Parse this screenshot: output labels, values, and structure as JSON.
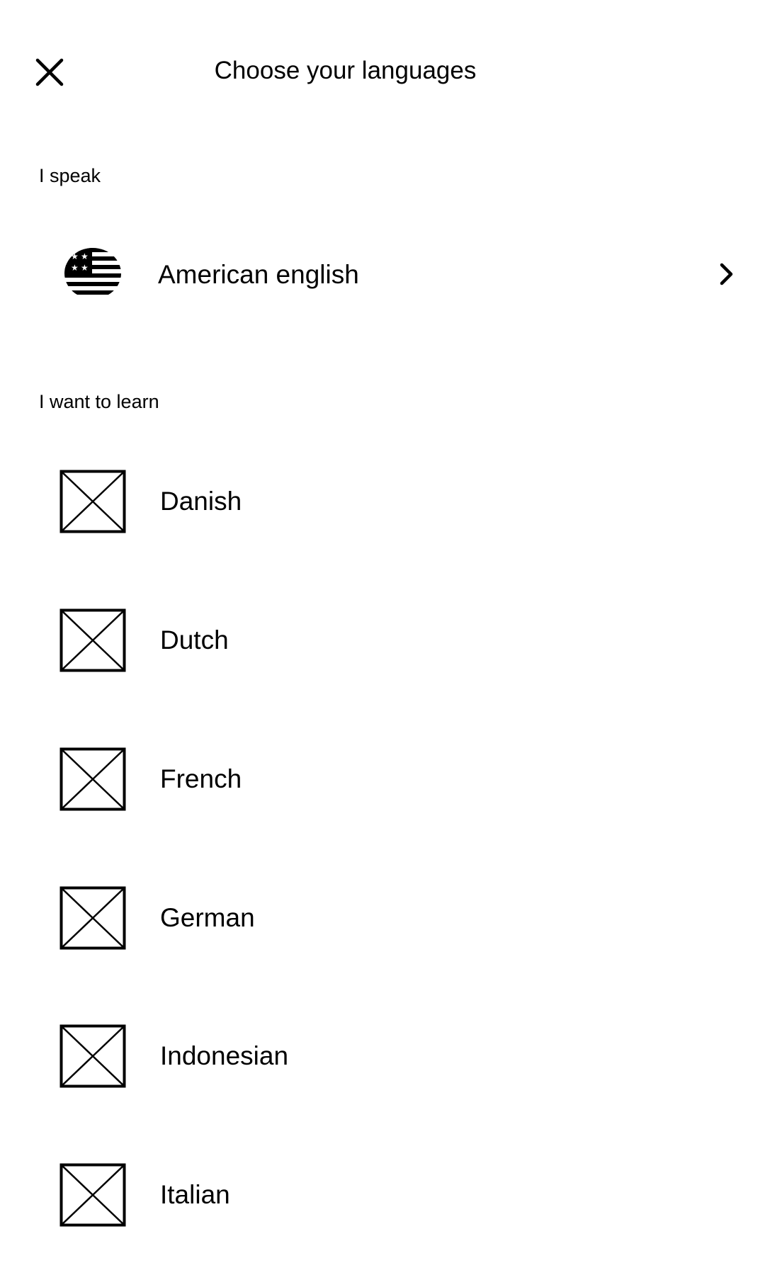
{
  "header": {
    "title": "Choose your languages",
    "close_icon": "close-icon"
  },
  "speak": {
    "section_label": "I speak",
    "language": "American english",
    "flag_icon": "us-flag-icon",
    "chevron_icon": "chevron-right-icon"
  },
  "learn": {
    "section_label": "I want to learn",
    "items": [
      {
        "label": "Danish",
        "icon": "image-placeholder-icon"
      },
      {
        "label": "Dutch",
        "icon": "image-placeholder-icon"
      },
      {
        "label": "French",
        "icon": "image-placeholder-icon"
      },
      {
        "label": "German",
        "icon": "image-placeholder-icon"
      },
      {
        "label": "Indonesian",
        "icon": "image-placeholder-icon"
      },
      {
        "label": "Italian",
        "icon": "image-placeholder-icon"
      }
    ]
  }
}
